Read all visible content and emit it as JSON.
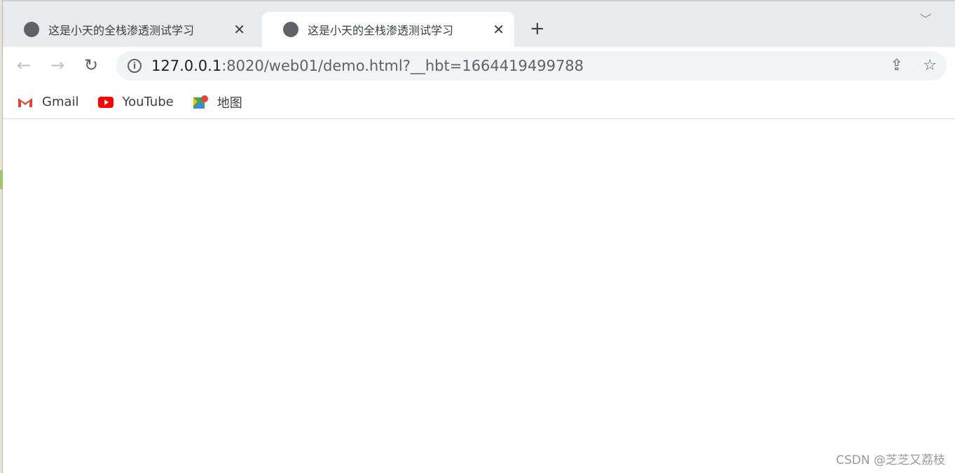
{
  "tabs": [
    {
      "title": "这是小天的全栈渗透测试学习",
      "active": false
    },
    {
      "title": "这是小天的全栈渗透测试学习",
      "active": true
    }
  ],
  "address": {
    "host": "127.0.0.1",
    "rest": ":8020/web01/demo.html?__hbt=1664419499788"
  },
  "bookmarks": [
    {
      "label": "Gmail",
      "icon": "gmail-icon"
    },
    {
      "label": "YouTube",
      "icon": "youtube-icon"
    },
    {
      "label": "地图",
      "icon": "maps-icon"
    }
  ],
  "watermark": "CSDN @芝芝又荔枝"
}
